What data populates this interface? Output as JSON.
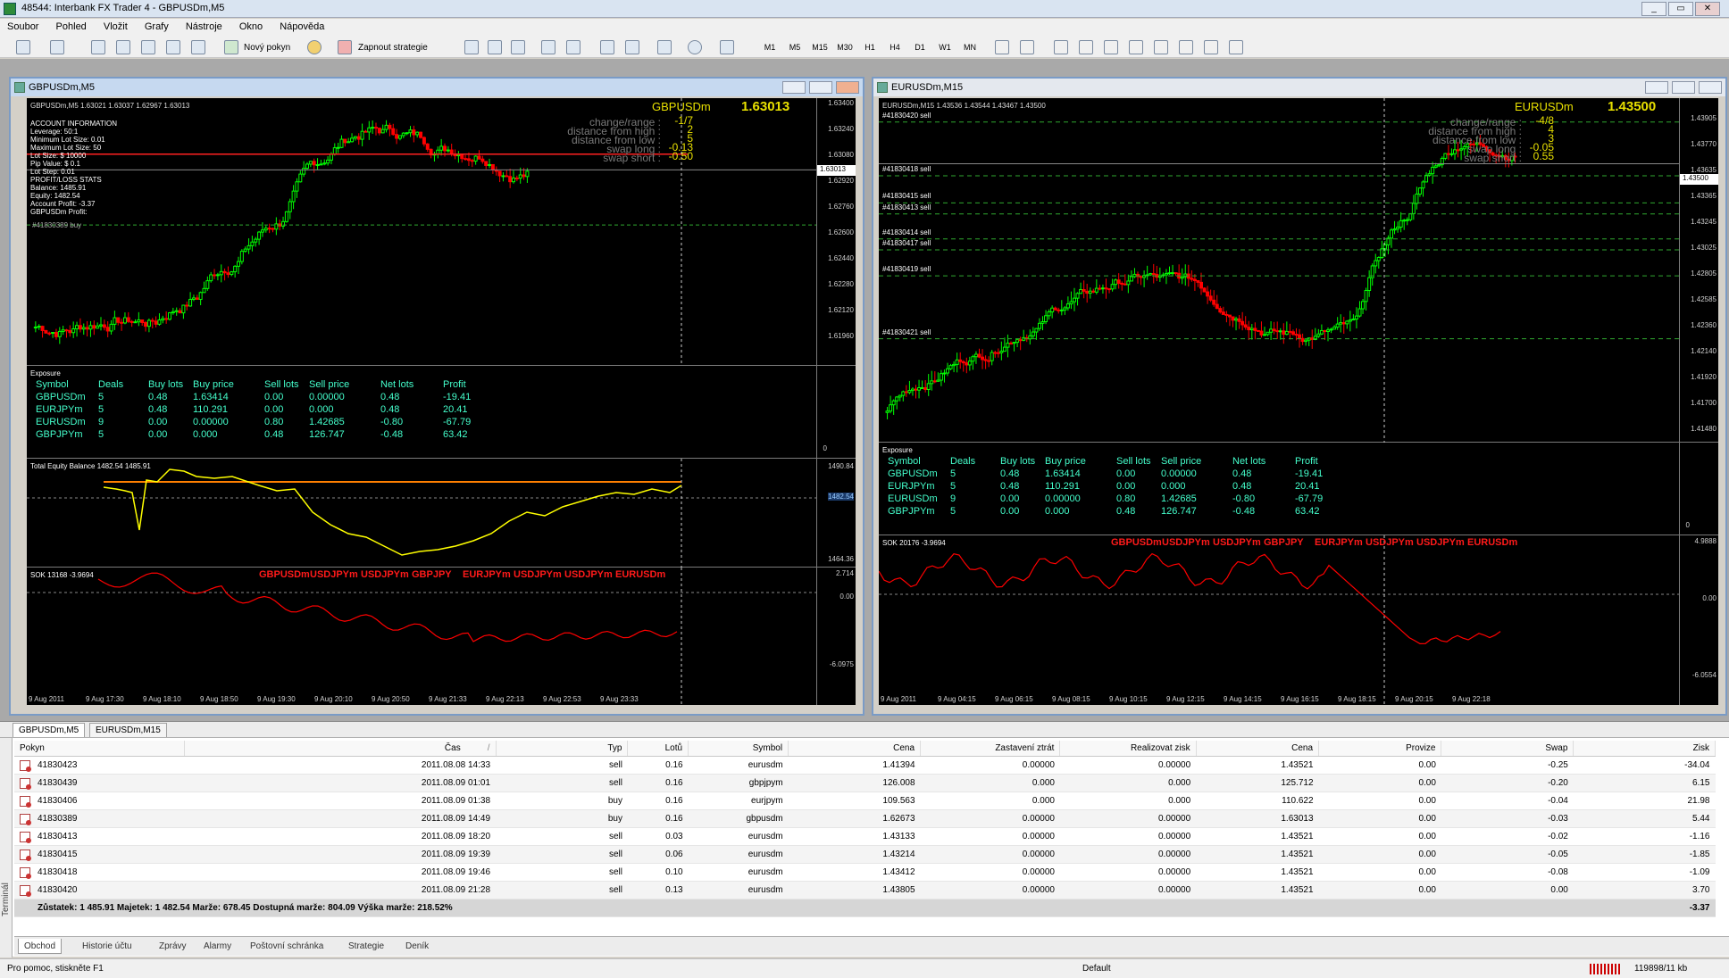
{
  "window": {
    "title": "48544: Interbank FX Trader 4 - GBPUSDm,M5",
    "btn_min": "_",
    "btn_max": "▭",
    "btn_close": "✕"
  },
  "menu": [
    "Soubor",
    "Pohled",
    "Vložit",
    "Grafy",
    "Nástroje",
    "Okno",
    "Nápověda"
  ],
  "toolbar": {
    "new_order": "Nový pokyn",
    "experts": "Zapnout strategie",
    "timeframes": [
      "M1",
      "M5",
      "M15",
      "M30",
      "H1",
      "H4",
      "D1",
      "W1",
      "MN"
    ]
  },
  "chart1": {
    "caption": "GBPUSDm,M5",
    "ohlc": "GBPUSDm,M5  1.63021 1.63037 1.62967 1.63013",
    "symbol": "GBPUSDm",
    "price": "1.63013",
    "stats": [
      {
        "label": "change/range :",
        "value": "-1/7"
      },
      {
        "label": "distance from high :",
        "value": "2"
      },
      {
        "label": "distance from low :",
        "value": "5"
      },
      {
        "label": "swap long :",
        "value": "-0.13"
      },
      {
        "label": "swap short :",
        "value": "-0.50"
      }
    ],
    "info": [
      "ACCOUNT INFORMATION",
      "Leverage: 50:1",
      "Minimum Lot Size: 0.01",
      "Maximum Lot Size: 50",
      "Lot Size: $ 10000",
      "Pip Value: $ 0.1",
      "Lot Step: 0.01",
      "PROFIT/LOSS STATS",
      "Balance: 1485.91",
      "Equity: 1482.54",
      "Account Profit: -3.37",
      "GBPUSDm Profit:"
    ],
    "overlap": "#41830389 buy",
    "price_axis": [
      "1.63400",
      "1.63240",
      "1.63080",
      "1.62920",
      "1.62760",
      "1.62600",
      "1.62440",
      "1.62280",
      "1.62120",
      "1.61960"
    ],
    "last_price_tag": "1.63013",
    "zero": "0",
    "equity_title": "Total Equity Balance 1482.54 1485.91",
    "equity_axis": [
      "1490.84",
      "1482.54",
      "1464.36"
    ],
    "sok_title": "SOK 13168 -3.9694",
    "sok_syms": [
      "GBPUSDm",
      "USDJPYm",
      "USDJPYm",
      "GBPJPY",
      "EURJPYm",
      "USDJPYm",
      "USDJPYm",
      "EURUSDm"
    ],
    "sok_axis": [
      "2.714",
      "0.00",
      "-6.0975"
    ],
    "times": [
      "9 Aug 2011",
      "9 Aug 17:30",
      "9 Aug 18:10",
      "9 Aug 18:50",
      "9 Aug 19:30",
      "9 Aug 20:10",
      "9 Aug 20:50",
      "9 Aug 21:33",
      "9 Aug 22:13",
      "9 Aug 22:53",
      "9 Aug 23:33"
    ]
  },
  "chart2": {
    "caption": "EURUSDm,M15",
    "ohlc": "EURUSDm,M15  1.43536 1.43544 1.43467 1.43500",
    "symbol": "EURUSDm",
    "price": "1.43500",
    "stats": [
      {
        "label": "change/range :",
        "value": "-4/8"
      },
      {
        "label": "distance from high :",
        "value": "4"
      },
      {
        "label": "distance from low :",
        "value": "3"
      },
      {
        "label": "swap long :",
        "value": "-0.05"
      },
      {
        "label": "swap short :",
        "value": "0.55"
      }
    ],
    "trades": [
      "#41830420 sell",
      "#41830418 sell",
      "#41830415 sell",
      "#41830413 sell",
      "#41830414 sell",
      "#41830417 sell",
      "#41830419 sell",
      "#41830421 sell"
    ],
    "price_axis": [
      "1.43905",
      "1.43770",
      "1.43635",
      "1.43365",
      "1.43245",
      "1.43025",
      "1.42805",
      "1.42585",
      "1.42360",
      "1.42140",
      "1.41920",
      "1.41700",
      "1.41480"
    ],
    "last_price_tag": "1.43500",
    "zero": "0",
    "sok_title": "SOK 20176 -3.9694",
    "sok_syms": [
      "GBPUSDm",
      "USDJPYm",
      "USDJPYm",
      "GBPJPY",
      "EURJPYm",
      "USDJPYm",
      "USDJPYm",
      "EURUSDm"
    ],
    "sok_axis": [
      "4.9888",
      "0.00",
      "-6.0554"
    ],
    "times": [
      "9 Aug 2011",
      "9 Aug 04:15",
      "9 Aug 06:15",
      "9 Aug 08:15",
      "9 Aug 10:15",
      "9 Aug 12:15",
      "9 Aug 14:15",
      "9 Aug 16:15",
      "9 Aug 18:15",
      "9 Aug 20:15",
      "9 Aug 22:18"
    ]
  },
  "exposure": {
    "title": "Exposure",
    "headers": [
      "Symbol",
      "Deals",
      "Buy lots",
      "Buy price",
      "Sell lots",
      "Sell price",
      "Net lots",
      "Profit"
    ],
    "rows": [
      [
        "GBPUSDm",
        "5",
        "0.48",
        "1.63414",
        "0.00",
        "0.00000",
        "0.48",
        "-19.41"
      ],
      [
        "EURJPYm",
        "5",
        "0.48",
        "110.291",
        "0.00",
        "0.000",
        "0.48",
        "20.41"
      ],
      [
        "EURUSDm",
        "9",
        "0.00",
        "0.00000",
        "0.80",
        "1.42685",
        "-0.80",
        "-67.79"
      ],
      [
        "GBPJPYm",
        "5",
        "0.00",
        "0.000",
        "0.48",
        "126.747",
        "-0.48",
        "63.42"
      ]
    ]
  },
  "chart_tabs": [
    "GBPUSDm,M5",
    "EURUSDm,M15"
  ],
  "orders": {
    "headers": [
      "Pokyn",
      "Čas",
      "Typ",
      "Lotů",
      "Symbol",
      "Cena",
      "Zastavení ztrát",
      "Realizovat zisk",
      "Cena",
      "Provize",
      "Swap",
      "Zisk"
    ],
    "sort_mark": "/",
    "rows": [
      [
        "41830423",
        "2011.08.08 14:33",
        "sell",
        "0.16",
        "eurusdm",
        "1.41394",
        "0.00000",
        "0.00000",
        "1.43521",
        "0.00",
        "-0.25",
        "-34.04"
      ],
      [
        "41830439",
        "2011.08.09 01:01",
        "sell",
        "0.16",
        "gbpjpym",
        "126.008",
        "0.000",
        "0.000",
        "125.712",
        "0.00",
        "-0.20",
        "6.15"
      ],
      [
        "41830406",
        "2011.08.09 01:38",
        "buy",
        "0.16",
        "eurjpym",
        "109.563",
        "0.000",
        "0.000",
        "110.622",
        "0.00",
        "-0.04",
        "21.98"
      ],
      [
        "41830389",
        "2011.08.09 14:49",
        "buy",
        "0.16",
        "gbpusdm",
        "1.62673",
        "0.00000",
        "0.00000",
        "1.63013",
        "0.00",
        "-0.03",
        "5.44"
      ],
      [
        "41830413",
        "2011.08.09 18:20",
        "sell",
        "0.03",
        "eurusdm",
        "1.43133",
        "0.00000",
        "0.00000",
        "1.43521",
        "0.00",
        "-0.02",
        "-1.16"
      ],
      [
        "41830415",
        "2011.08.09 19:39",
        "sell",
        "0.06",
        "eurusdm",
        "1.43214",
        "0.00000",
        "0.00000",
        "1.43521",
        "0.00",
        "-0.05",
        "-1.85"
      ],
      [
        "41830418",
        "2011.08.09 19:46",
        "sell",
        "0.10",
        "eurusdm",
        "1.43412",
        "0.00000",
        "0.00000",
        "1.43521",
        "0.00",
        "-0.08",
        "-1.09"
      ],
      [
        "41830420",
        "2011.08.09 21:28",
        "sell",
        "0.13",
        "eurusdm",
        "1.43805",
        "0.00000",
        "0.00000",
        "1.43521",
        "0.00",
        "0.00",
        "3.70"
      ]
    ],
    "summary": "Zůstatek: 1 485.91  Majetek: 1 482.54  Marže: 678.45  Dostupná marže: 804.09  Výška marže: 218.52%",
    "summary_profit": "-3.37"
  },
  "terminal_side": "Terminál",
  "terminal_tabs": [
    "Obchod",
    "Historie účtu",
    "Zprávy",
    "Alarmy",
    "Poštovní schránka",
    "Strategie",
    "Deník"
  ],
  "status": {
    "help": "Pro pomoc, stiskněte F1",
    "profile": "Default",
    "traffic": "119898/11 kb"
  },
  "colors": {
    "bull": "#00ff00",
    "bear": "#ff0000",
    "equity": "#ffff00",
    "balance": "#ff7f00",
    "sok": "#ff0000",
    "exposure_text": "#44ffcc"
  }
}
